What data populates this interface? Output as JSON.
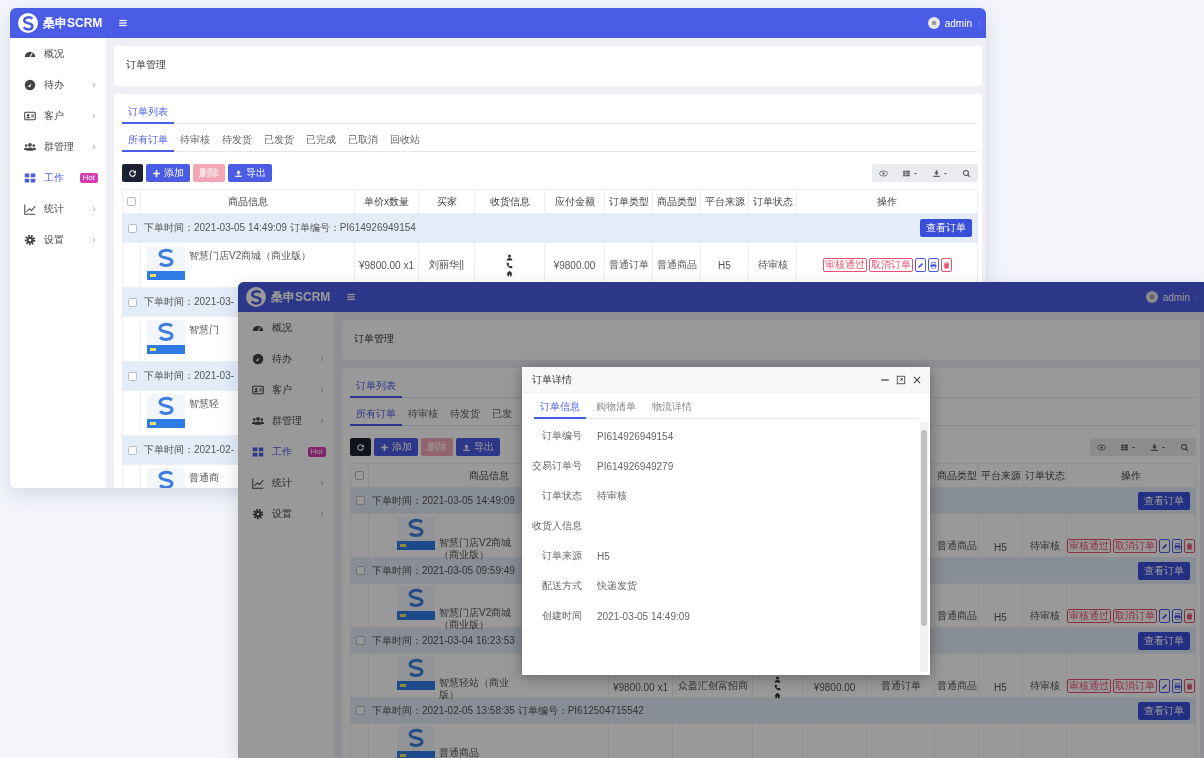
{
  "back_window": {
    "brand": "桑申SCRM",
    "user": "admin",
    "sidebar": [
      {
        "label": "概况",
        "submenu": false,
        "selected": false
      },
      {
        "label": "待办",
        "submenu": true,
        "selected": false
      },
      {
        "label": "客户",
        "submenu": true,
        "selected": false
      },
      {
        "label": "群管理",
        "submenu": true,
        "selected": false
      },
      {
        "label": "工作",
        "submenu": false,
        "selected": true,
        "badge": "Hot"
      },
      {
        "label": "统计",
        "submenu": true,
        "selected": false
      },
      {
        "label": "设置",
        "submenu": true,
        "selected": false
      }
    ],
    "page_title": "订单管理",
    "list_tabs": [
      {
        "label": "订单列表",
        "selected": true
      }
    ],
    "status_tabs": [
      {
        "label": "所有订单",
        "selected": true
      },
      {
        "label": "待审核",
        "selected": false
      },
      {
        "label": "待发货",
        "selected": false
      },
      {
        "label": "已发货",
        "selected": false
      },
      {
        "label": "已完成",
        "selected": false
      },
      {
        "label": "已取消",
        "selected": false
      },
      {
        "label": "回收站",
        "selected": false
      }
    ],
    "toolbar": [
      {
        "kind": "refresh",
        "disabled": false
      },
      {
        "kind": "add",
        "label": "添加",
        "disabled": false
      },
      {
        "kind": "delete",
        "label": "删除",
        "disabled": true
      },
      {
        "kind": "export",
        "label": "导出",
        "disabled": false
      }
    ],
    "table": {
      "header_checked": false,
      "columns": {
        "product": "商品信息",
        "price_qty": "单价x数量",
        "buyer": "买家",
        "shipping": "收货信息",
        "amount": "应付金额",
        "order_type": "订单类型",
        "product_type": "商品类型",
        "platform": "平台来源",
        "status": "订单状态",
        "actions": "操作"
      },
      "rows": [
        {
          "kind": "group",
          "checked": false,
          "text": "下单时间：2021-03-05 14:49:09  订单编号：PI614926949154",
          "button": "查看订单"
        },
        {
          "kind": "product",
          "name": "智慧门店V2商城（商业版）",
          "price_qty": "¥9800.00 x1",
          "buyer": "刘丽华||",
          "shipping_icons": true,
          "amount": "¥9800.00",
          "order_type": "普通订单",
          "product_type": "普通商品",
          "platform": "H5",
          "status": "待审核",
          "actions": [
            "审核通过",
            "取消订单"
          ],
          "tool_buttons": true
        },
        {
          "kind": "group",
          "checked": false,
          "text": "下单时间：2021-03-"
        },
        {
          "kind": "product",
          "name": "智慧门"
        },
        {
          "kind": "group",
          "checked": false,
          "text": "下单时间：2021-03-"
        },
        {
          "kind": "product",
          "name": "智慧轻"
        },
        {
          "kind": "group",
          "checked": false,
          "text": "下单时间：2021-02-"
        },
        {
          "kind": "product",
          "name": "普通商"
        }
      ]
    }
  },
  "front_window": {
    "brand": "桑申SCRM",
    "user": "admin",
    "sidebar": [
      {
        "label": "概况",
        "submenu": false,
        "selected": false
      },
      {
        "label": "待办",
        "submenu": true,
        "selected": false
      },
      {
        "label": "客户",
        "submenu": true,
        "selected": false
      },
      {
        "label": "群管理",
        "submenu": true,
        "selected": false
      },
      {
        "label": "工作",
        "submenu": false,
        "selected": true,
        "badge": "Hot"
      },
      {
        "label": "统计",
        "submenu": true,
        "selected": false
      },
      {
        "label": "设置",
        "submenu": true,
        "selected": false
      }
    ],
    "page_title": "订单管理",
    "list_tabs": [
      {
        "label": "订单列表",
        "selected": true
      }
    ],
    "status_tabs": [
      {
        "label": "所有订单",
        "selected": true
      },
      {
        "label": "待审核",
        "selected": false
      },
      {
        "label": "待发货",
        "selected": false
      },
      {
        "label": "已发",
        "selected": false
      }
    ],
    "toolbar": [
      {
        "kind": "refresh",
        "disabled": false
      },
      {
        "kind": "add",
        "label": "添加",
        "disabled": false
      },
      {
        "kind": "delete",
        "label": "删除",
        "disabled": true
      },
      {
        "kind": "export",
        "label": "导出",
        "disabled": false
      }
    ],
    "table": {
      "header_checked": false,
      "columns": {
        "product": "商品信息",
        "product_type": "商品类型",
        "platform": "平台来源",
        "status": "订单状态",
        "actions": "操作"
      },
      "rows": [
        {
          "kind": "group",
          "checked": false,
          "text": "下单时间：2021-03-05 14:49:09",
          "button": "查看订单"
        },
        {
          "kind": "product",
          "name": "智慧门店V2商城（商业版）",
          "product_type": "普通商品",
          "platform": "H5",
          "status": "待审核",
          "actions": [
            "审核通过",
            "取消订单"
          ],
          "tool_buttons": true
        },
        {
          "kind": "group",
          "checked": false,
          "text": "下单时间：2021-03-05 09:59:49",
          "button": "查看订单"
        },
        {
          "kind": "product",
          "name": "智慧门店V2商城（商业版）",
          "product_type": "普通商品",
          "platform": "H5",
          "status": "待审核",
          "actions": [
            "审核通过",
            "取消订单"
          ],
          "tool_buttons": true
        },
        {
          "kind": "group",
          "checked": false,
          "text": "下单时间：2021-03-04 16:23:53",
          "button": "查看订单"
        },
        {
          "kind": "product",
          "name": "智慧轻站（商业版）",
          "price_qty": "¥9800.00 x1",
          "buyer": "众盈汇创富招商",
          "shipping_icons": true,
          "amount": "¥9800.00",
          "order_type": "普通订单",
          "product_type": "普通商品",
          "platform": "H5",
          "status": "待审核",
          "actions": [
            "审核通过",
            "取消订单"
          ],
          "tool_buttons": true
        },
        {
          "kind": "group",
          "checked": false,
          "text": "下单时间：2021-02-05 13:58:35  订单编号：PI612504715542",
          "button": "查看订单"
        },
        {
          "kind": "product",
          "name": "普通商品"
        }
      ]
    }
  },
  "modal": {
    "title": "订单详情",
    "tabs": [
      {
        "label": "订单信息",
        "selected": true
      },
      {
        "label": "购物清单",
        "selected": false
      },
      {
        "label": "物流详情",
        "selected": false
      }
    ],
    "fields": [
      {
        "label": "订单编号",
        "value": "PI614926949154"
      },
      {
        "label": "交易订单号",
        "value": "PI614926949279"
      },
      {
        "label": "订单状态",
        "value": "待审核"
      },
      {
        "label": "收货人信息"
      },
      {
        "label": "订单来源",
        "value": "H5"
      },
      {
        "label": "配送方式",
        "value": "快递发货"
      },
      {
        "label": "创建时间",
        "value": "2021-03-05 14:49:09"
      }
    ]
  }
}
